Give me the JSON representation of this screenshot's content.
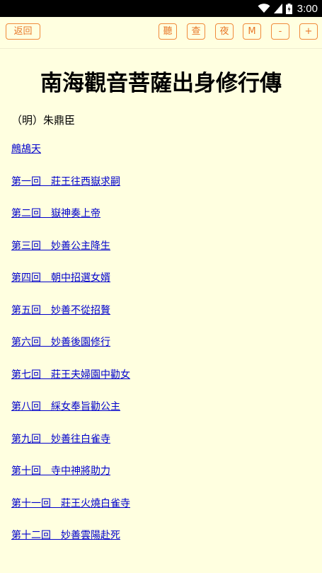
{
  "status_bar": {
    "time": "3:00"
  },
  "toolbar": {
    "back_label": "返回",
    "listen_label": "聽",
    "search_label": "查",
    "night_label": "夜",
    "menu_label": "M",
    "font_smaller_label": "-",
    "font_larger_label": "+"
  },
  "book": {
    "title": "南海觀音菩薩出身修行傳",
    "author": "（明）朱鼎臣",
    "chapters": [
      "鷓鴣天",
      "第一回　莊王往西嶽求嗣",
      "第二回　嶽神奏上帝",
      "第三回　妙善公主降生",
      "第四回　朝中招選女婿",
      "第五回　妙善不從招贅",
      "第六回　妙善後園修行",
      "第七回　莊王夫婦園中勸女",
      "第八回　綵女奉旨勸公主",
      "第九回　妙善往白雀寺",
      "第十回　寺中神將助力",
      "第十一回　莊王火燒白雀寺",
      "第十二回　妙善雲陽赴死"
    ]
  },
  "colors": {
    "background": "#ffffe0",
    "accent": "#e8782a",
    "link": "#0000cc"
  }
}
